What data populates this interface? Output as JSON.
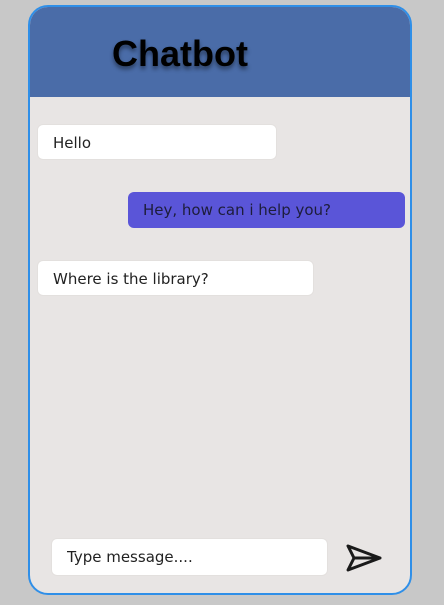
{
  "header": {
    "title": "Chatbot"
  },
  "messages": [
    {
      "sender": "user",
      "text": "Hello"
    },
    {
      "sender": "bot",
      "text": "Hey, how can i help you?"
    },
    {
      "sender": "user",
      "text": "Where is the library?"
    }
  ],
  "composer": {
    "placeholder": "Type message....",
    "value": "",
    "send_icon": "send-icon"
  },
  "colors": {
    "header": "#4a6ca8",
    "border": "#2f8fe8",
    "chat_background": "#e8e5e4",
    "page_background": "#c8c8c8",
    "outgoing_bubble": "#5a55d8",
    "incoming_bubble": "#ffffff"
  }
}
